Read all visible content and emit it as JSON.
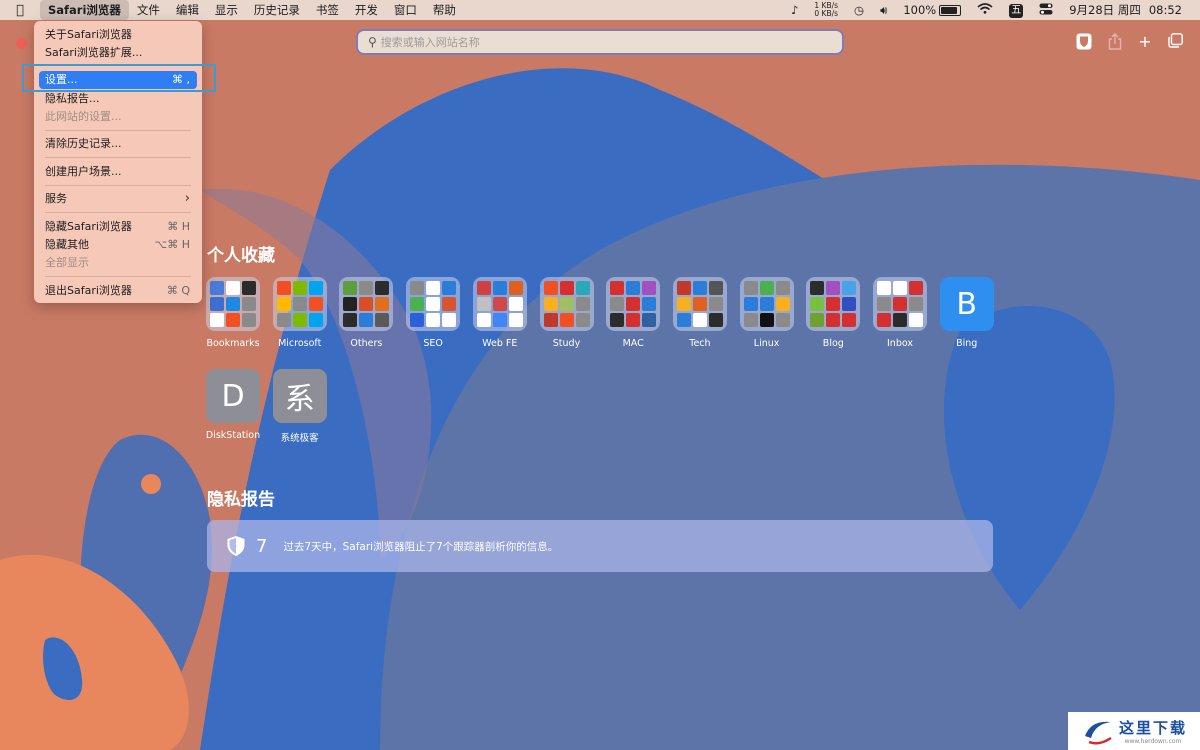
{
  "colors": {
    "accent": "#2f7ef4",
    "close": "#ee5f57",
    "wall_orange": "#c97a64",
    "wall_blue": "#3a6cc1",
    "wall_slate": "#5d74a8"
  },
  "menubar": {
    "apple_icon": "apple-logo-icon",
    "items": [
      "Safari浏览器",
      "文件",
      "编辑",
      "显示",
      "历史记录",
      "书签",
      "开发",
      "窗口",
      "帮助"
    ],
    "status": {
      "net_up": "1 KB/s",
      "net_down": "0 KB/s",
      "battery": "100%",
      "ime": "五",
      "date": "9月28日 周四",
      "time": "08:52"
    }
  },
  "toolbar": {
    "search_placeholder": "搜索或输入网站名称"
  },
  "menu": {
    "items": [
      {
        "label": "关于Safari浏览器",
        "key": "",
        "state": ""
      },
      {
        "label": "Safari浏览器扩展...",
        "key": "",
        "state": ""
      },
      {
        "label": "设置...",
        "key": "⌘ ,",
        "state": "selected"
      },
      {
        "label": "隐私报告...",
        "key": "",
        "state": ""
      },
      {
        "label": "此网站的设置...",
        "key": "",
        "state": "disabled"
      },
      {
        "label": "清除历史记录...",
        "key": "",
        "state": ""
      },
      {
        "label": "创建用户场景...",
        "key": "",
        "state": ""
      },
      {
        "label": "服务",
        "key": "›",
        "state": ""
      },
      {
        "label": "隐藏Safari浏览器",
        "key": "⌘ H",
        "state": ""
      },
      {
        "label": "隐藏其他",
        "key": "⌥⌘ H",
        "state": ""
      },
      {
        "label": "全部显示",
        "key": "",
        "state": "disabled"
      },
      {
        "label": "退出Safari浏览器",
        "key": "⌘ Q",
        "state": ""
      }
    ]
  },
  "favorites": {
    "title": "个人收藏",
    "items": [
      {
        "label": "Bookmarks",
        "glyph": ""
      },
      {
        "label": "Microsoft",
        "glyph": ""
      },
      {
        "label": "Others",
        "glyph": ""
      },
      {
        "label": "SEO",
        "glyph": ""
      },
      {
        "label": "Web FE",
        "glyph": ""
      },
      {
        "label": "Study",
        "glyph": ""
      },
      {
        "label": "MAC",
        "glyph": ""
      },
      {
        "label": "Tech",
        "glyph": ""
      },
      {
        "label": "Linux",
        "glyph": ""
      },
      {
        "label": "Blog",
        "glyph": ""
      },
      {
        "label": "Inbox",
        "glyph": ""
      },
      {
        "label": "Bing",
        "glyph": "B"
      },
      {
        "label": "DiskStation",
        "glyph": "D"
      },
      {
        "label": "系统极客",
        "glyph": "系"
      }
    ]
  },
  "privacy": {
    "title": "隐私报告",
    "count": "7",
    "text": "过去7天中，Safari浏览器阻止了7个跟踪器剖析你的信息。"
  },
  "watermark": {
    "text": "这里下载",
    "sub": "www.herdown.com"
  }
}
